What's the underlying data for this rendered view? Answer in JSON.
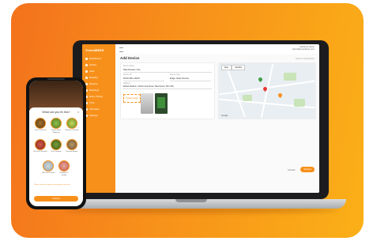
{
  "app": {
    "brand": "Trees4BEES",
    "nav": [
      "Dashboard",
      "Orders",
      "Jobs",
      "Booking",
      "Reports",
      "Bookings",
      "Entry Pricing",
      "Time",
      "Schedule",
      "Settings"
    ],
    "user": {
      "name": "Gardener Admin",
      "email": "admin@trees4bees.com"
    },
    "page_title": "Add Device",
    "breadcrumb": "Home / Add Device"
  },
  "form": {
    "name_label": "Device Name",
    "name_value": "Manchester City",
    "id_label": "Device ID",
    "id_value": "MCR-001-2000",
    "type_label": "Device Type",
    "type_value": "Edge Gate Device",
    "address_label": "Address",
    "address_value": "Etihad Stadium, Ashton New Road, Manchester, M11 3FF",
    "upload_label": "Upload Image"
  },
  "map": {
    "tab_map": "Map",
    "tab_satellite": "Satellite",
    "google_label": "Google"
  },
  "actions": {
    "cancel": "Cancel",
    "submit": "Submit"
  },
  "phone": {
    "question": "What can you fix this?",
    "options": [
      {
        "label": "Litter Clean Up"
      },
      {
        "label": "Plants Need Watering"
      },
      {
        "label": "Flowers & Shrubs"
      },
      {
        "label": "Bin Full / Blocked"
      },
      {
        "label": "Tree Damage"
      },
      {
        "label": "Fencing Repair"
      },
      {
        "label": "No Issue Found"
      },
      {
        "label": "Vandalism / Graffiti"
      }
    ],
    "note": "Please select the options that apply to this area",
    "submit": "Submit"
  },
  "colors": {
    "accent": "#f7901a",
    "sidebar": "#f7901a"
  }
}
